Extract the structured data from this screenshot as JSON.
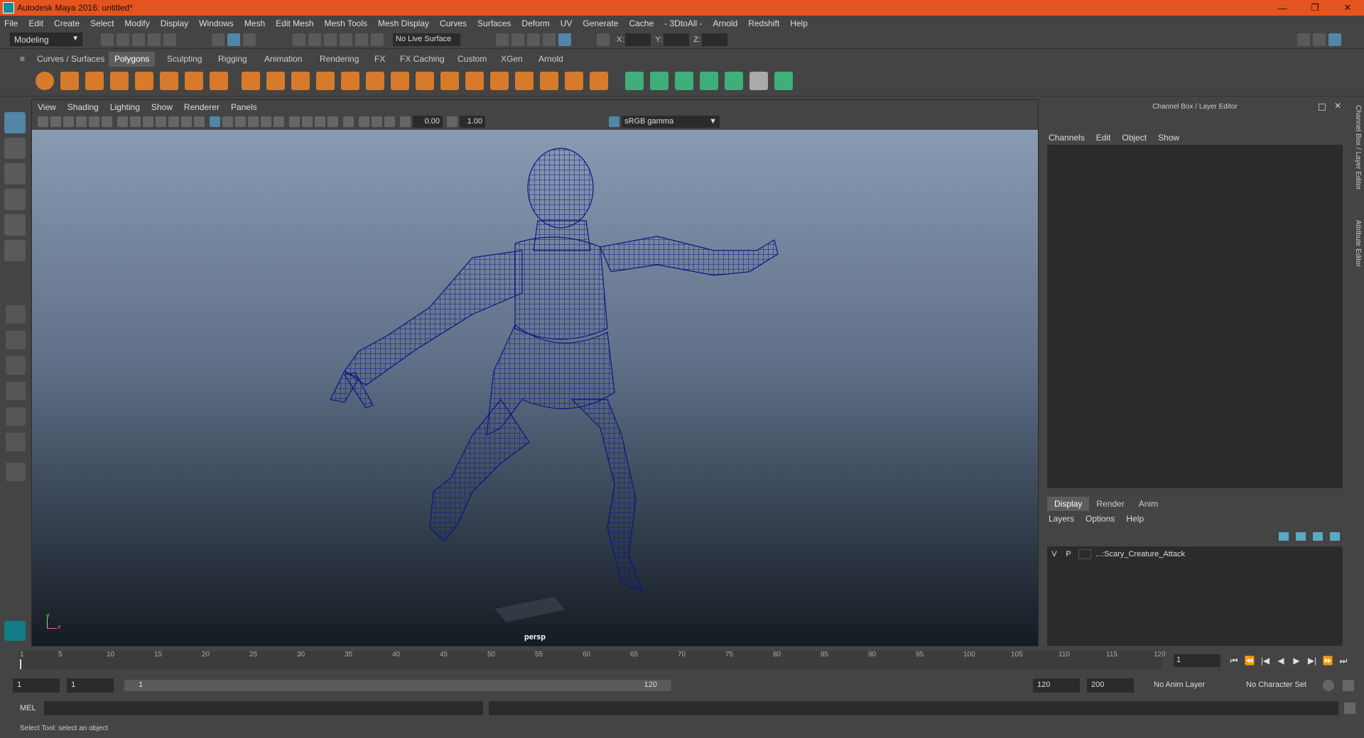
{
  "window": {
    "title": "Autodesk Maya 2016: untitled*",
    "min": "—",
    "max": "❐",
    "close": "✕"
  },
  "menu": [
    "File",
    "Edit",
    "Create",
    "Select",
    "Modify",
    "Display",
    "Windows",
    "Mesh",
    "Edit Mesh",
    "Mesh Tools",
    "Mesh Display",
    "Curves",
    "Surfaces",
    "Deform",
    "UV",
    "Generate",
    "Cache",
    "- 3DtoAll -",
    "Arnold",
    "Redshift",
    "Help"
  ],
  "status_line": {
    "mode": "Modeling",
    "live_surface": "No Live Surface",
    "x_label": "X:",
    "y_label": "Y:",
    "z_label": "Z:"
  },
  "shelf_tabs": [
    "Curves / Surfaces",
    "Polygons",
    "Sculpting",
    "Rigging",
    "Animation",
    "Rendering",
    "FX",
    "FX Caching",
    "Custom",
    "XGen",
    "Arnold"
  ],
  "shelf_active": "Polygons",
  "viewport": {
    "menu": [
      "View",
      "Shading",
      "Lighting",
      "Show",
      "Renderer",
      "Panels"
    ],
    "exposure": "0.00",
    "gamma": "1.00",
    "color_space": "sRGB gamma",
    "camera": "persp",
    "axis_y": "y",
    "axis_x": "x"
  },
  "channel_box": {
    "header": "Channel Box / Layer Editor",
    "menu": [
      "Channels",
      "Edit",
      "Object",
      "Show"
    ],
    "layer_tabs": [
      "Display",
      "Render",
      "Anim"
    ],
    "layer_tab_active": "Display",
    "layer_menu": [
      "Layers",
      "Options",
      "Help"
    ],
    "layer": {
      "v": "V",
      "p": "P",
      "name": "...:Scary_Creature_Attack"
    }
  },
  "side_tabs": [
    "Channel Box / Layer Editor",
    "Attribute Editor"
  ],
  "timeline": {
    "ticks": [
      "1",
      "5",
      "10",
      "15",
      "20",
      "25",
      "30",
      "35",
      "40",
      "45",
      "50",
      "55",
      "60",
      "65",
      "70",
      "75",
      "80",
      "85",
      "90",
      "95",
      "100",
      "105",
      "110",
      "115",
      "120"
    ],
    "current_frame": "1"
  },
  "range": {
    "start": "1",
    "playback_start": "1",
    "slider_start": "1",
    "slider_end": "120",
    "playback_end": "120",
    "end": "200",
    "anim_layer": "No Anim Layer",
    "char_set": "No Character Set"
  },
  "command": {
    "label": "MEL"
  },
  "help_line": "Select Tool: select an object"
}
